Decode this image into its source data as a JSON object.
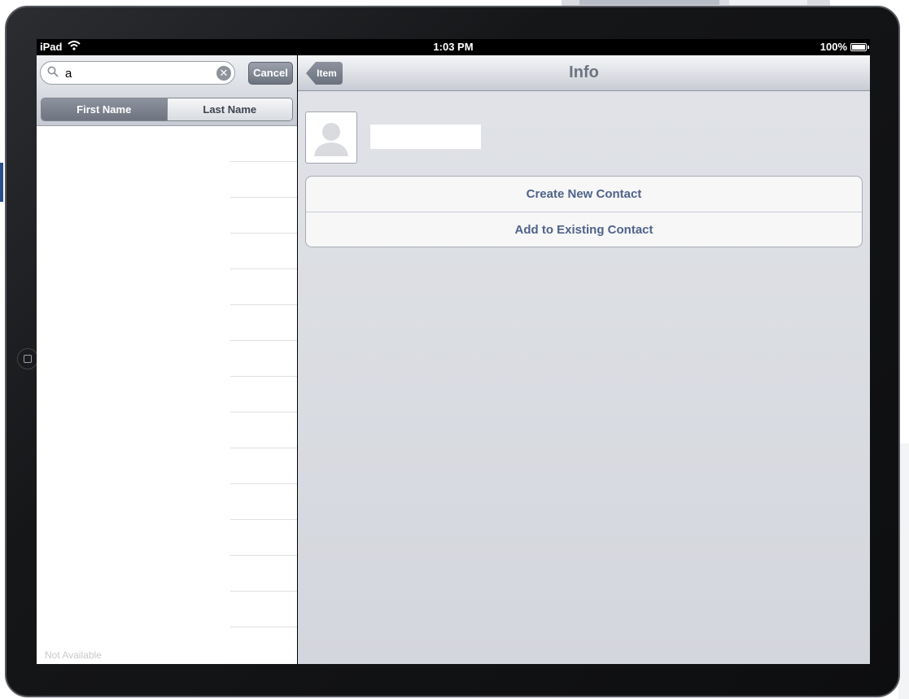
{
  "status_bar": {
    "carrier": "iPad",
    "time": "1:03 PM",
    "battery": "100%"
  },
  "search": {
    "value": "a",
    "cancel_label": "Cancel",
    "scope": [
      "First Name",
      "Last Name"
    ]
  },
  "results": {
    "footer": "Not Available"
  },
  "nav": {
    "back_label": "Item",
    "title": "Info"
  },
  "actions": {
    "create": "Create New Contact",
    "add_existing": "Add to Existing Contact"
  }
}
